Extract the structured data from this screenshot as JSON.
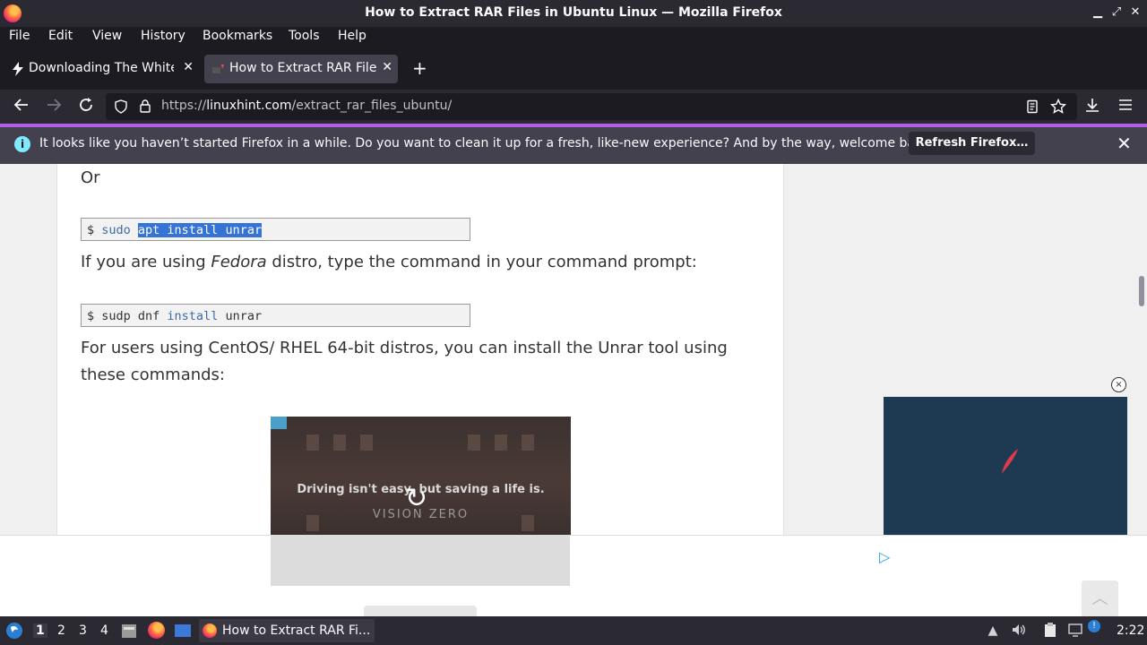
{
  "window": {
    "title": "How to Extract RAR Files in Ubuntu Linux — Mozilla Firefox",
    "minimize": "▁",
    "maximize": "⤢",
    "close": "✕"
  },
  "menu": {
    "items": [
      {
        "label": "File",
        "key": "F"
      },
      {
        "label": "Edit",
        "key": "E"
      },
      {
        "label": "View",
        "key": "V"
      },
      {
        "label": "History",
        "key": "s"
      },
      {
        "label": "Bookmarks",
        "key": "B"
      },
      {
        "label": "Tools",
        "key": "T"
      },
      {
        "label": "Help",
        "key": "H"
      }
    ]
  },
  "tabs": [
    {
      "label": "Downloading The White H",
      "active": false,
      "close": "✕"
    },
    {
      "label": "How to Extract RAR Files",
      "active": true,
      "close": "✕"
    }
  ],
  "new_tab": "+",
  "nav": {
    "url_prefix": "https://",
    "url_domain": "linuxhint.com",
    "url_path": "/extract_rar_files_ubuntu/"
  },
  "notification": {
    "message": "It looks like you haven’t started Firefox in a while. Do you want to clean it up for a fresh, like-new experience? And by the way, welcome back!",
    "button": "Refresh Firefox…",
    "info": "i",
    "close": "✕"
  },
  "article": {
    "or": "Or",
    "code1": {
      "prompt": "$ ",
      "cmd": "sudo ",
      "selected": "apt install unrar"
    },
    "fedora_pre": "If you are using ",
    "fedora_em": "Fedora",
    "fedora_post": " distro, type the command in your command prompt:",
    "code2": {
      "prompt": "$ ",
      "cmd1": "sudp dnf ",
      "kw": "install",
      "cmd2": " unrar"
    },
    "centos_line1": "For users using CentOS/ RHEL 64-bit distros, you can install the Unrar tool using",
    "centos_line2": "these commands:"
  },
  "video": {
    "caption": "Driving isn't easy, but saving a life is.",
    "brand": "VISION ZERO",
    "replay": "↻"
  },
  "ad": {
    "close": "×",
    "play": "▷",
    "to_top": "︿"
  },
  "taskbar": {
    "workspaces": [
      "1",
      "2",
      "3",
      "4"
    ],
    "active_workspace": "1",
    "task_label": "How to Extract RAR Fi...",
    "clock": "2:22",
    "notif_badge": "!"
  }
}
